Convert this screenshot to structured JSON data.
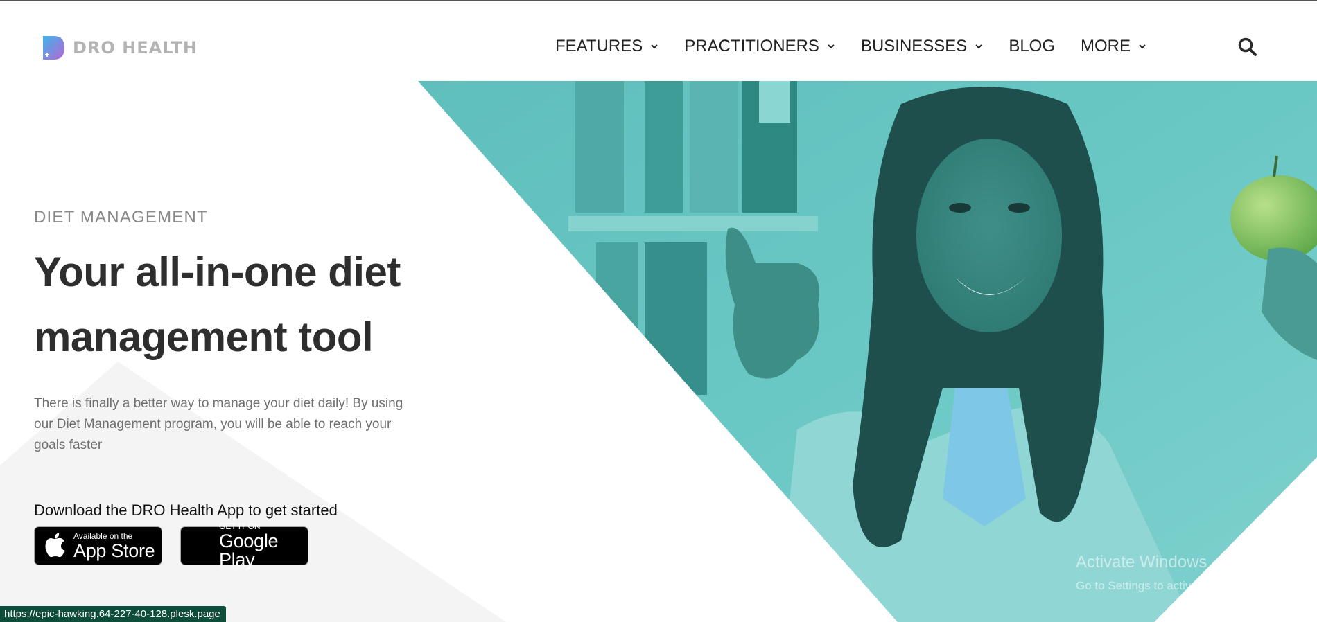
{
  "brand": {
    "name": "DRO HEALTH",
    "gradient": [
      "#4ab3e6",
      "#b968d8"
    ]
  },
  "nav": {
    "items": [
      {
        "label": "FEATURES",
        "dropdown": true
      },
      {
        "label": "PRACTITIONERS",
        "dropdown": true
      },
      {
        "label": "BUSINESSES",
        "dropdown": true
      },
      {
        "label": "BLOG",
        "dropdown": false
      },
      {
        "label": "MORE",
        "dropdown": true
      }
    ],
    "search_icon": "search-icon"
  },
  "hero": {
    "eyebrow": "DIET MANAGEMENT",
    "headline_line1": "Your all-in-one diet",
    "headline_line2": "management tool",
    "description": "There is finally a better way to manage your diet daily! By using our Diet Management program, you will be able to reach your goals faster",
    "download_title": "Download the DRO Health App to get started",
    "app_store": {
      "small": "Available on the",
      "big": "App Store"
    },
    "google_play": {
      "small": "GET IT ON",
      "big": "Google Play"
    },
    "accent_teal": "#5bbfbd"
  },
  "watermark": {
    "title": "Activate Windows",
    "subtitle": "Go to Settings to activate Windows."
  },
  "status_url": "https://epic-hawking.64-227-40-128.plesk.page"
}
